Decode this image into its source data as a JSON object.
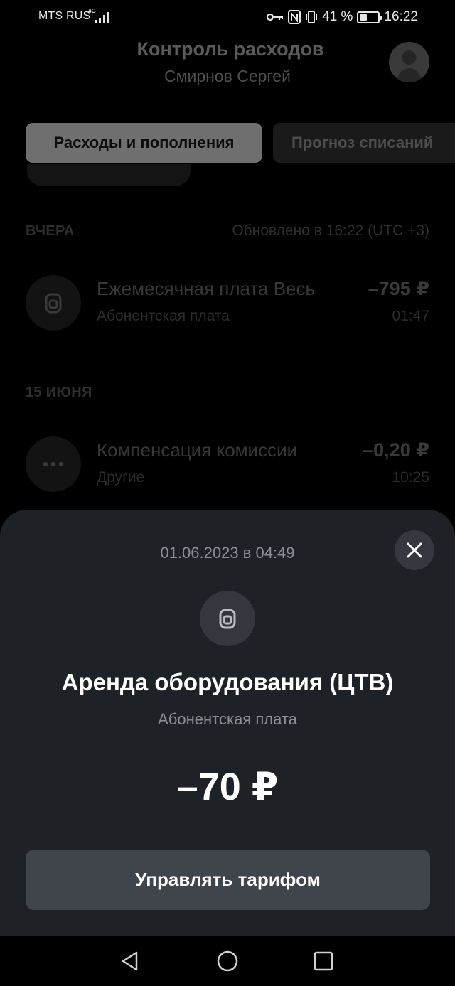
{
  "status_bar": {
    "carrier": "MTS RUS",
    "network": "4G",
    "battery_percent": "41 %",
    "battery_level": 0.41,
    "time": "16:22"
  },
  "header": {
    "title": "Контроль расходов",
    "subtitle": "Смирнов Сергей"
  },
  "tabs": [
    {
      "label": "Расходы и пополнения",
      "active": true
    },
    {
      "label": "Прогноз списаний",
      "active": false
    }
  ],
  "sections": [
    {
      "label": "ВЧЕРА",
      "updated": "Обновлено в  16:22 (UTC +3)",
      "transactions": [
        {
          "icon": "lock-icon",
          "name": "Ежемесячная плата Весь",
          "category": "Абонентская плата",
          "amount": "–795 ₽",
          "time": "01:47"
        }
      ]
    },
    {
      "label": "15 ИЮНЯ",
      "transactions": [
        {
          "icon": "more-dots-icon",
          "name": "Компенсация комиссии",
          "category": "Другие",
          "amount": "–0,20 ₽",
          "time": "10:25"
        }
      ]
    }
  ],
  "sheet": {
    "date": "01.06.2023 в 04:49",
    "title": "Аренда оборудования (ЦТВ)",
    "category": "Абонентская плата",
    "amount": "–70 ₽",
    "button_label": "Управлять тарифом"
  },
  "colors": {
    "sheet_bg": "#1e2125",
    "button_bg": "#40454c",
    "active_tab_bg": "#6f6f6f"
  }
}
